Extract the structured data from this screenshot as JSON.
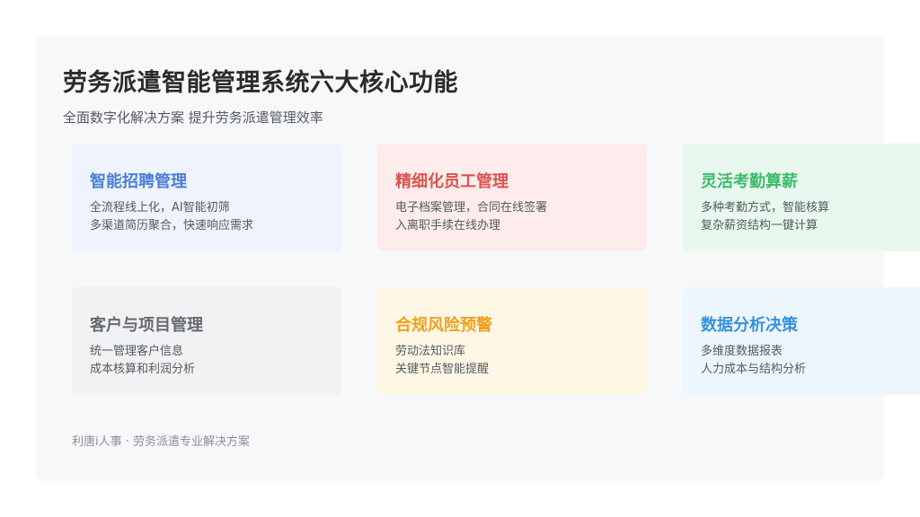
{
  "title": "劳务派遣智能管理系统六大核心功能",
  "subtitle": "全面数字化解决方案 提升劳务派遣管理效率",
  "cards": [
    {
      "title": "智能招聘管理",
      "title_color": "#4a7fd4",
      "lines": [
        "全流程线上化，AI智能初筛",
        "多渠道简历聚合，快速响应需求"
      ]
    },
    {
      "title": "精细化员工管理",
      "title_color": "#d9544f",
      "lines": [
        "电子档案管理，合同在线签署",
        "入离职手续在线办理"
      ]
    },
    {
      "title": "灵活考勤算薪",
      "title_color": "#3dbb6c",
      "lines": [
        "多种考勤方式，智能核算",
        "复杂薪资结构一键计算"
      ]
    },
    {
      "title": "客户与项目管理",
      "title_color": "#666a70",
      "lines": [
        "统一管理客户信息",
        "成本核算和利润分析"
      ]
    },
    {
      "title": "合规风险预警",
      "title_color": "#f0a020",
      "lines": [
        "劳动法知识库",
        "关键节点智能提醒"
      ]
    },
    {
      "title": "数据分析决策",
      "title_color": "#3592de",
      "lines": [
        "多维度数据报表",
        "人力成本与结构分析"
      ]
    }
  ],
  "footer": "利唐i人事 · 劳务派遣专业解决方案"
}
